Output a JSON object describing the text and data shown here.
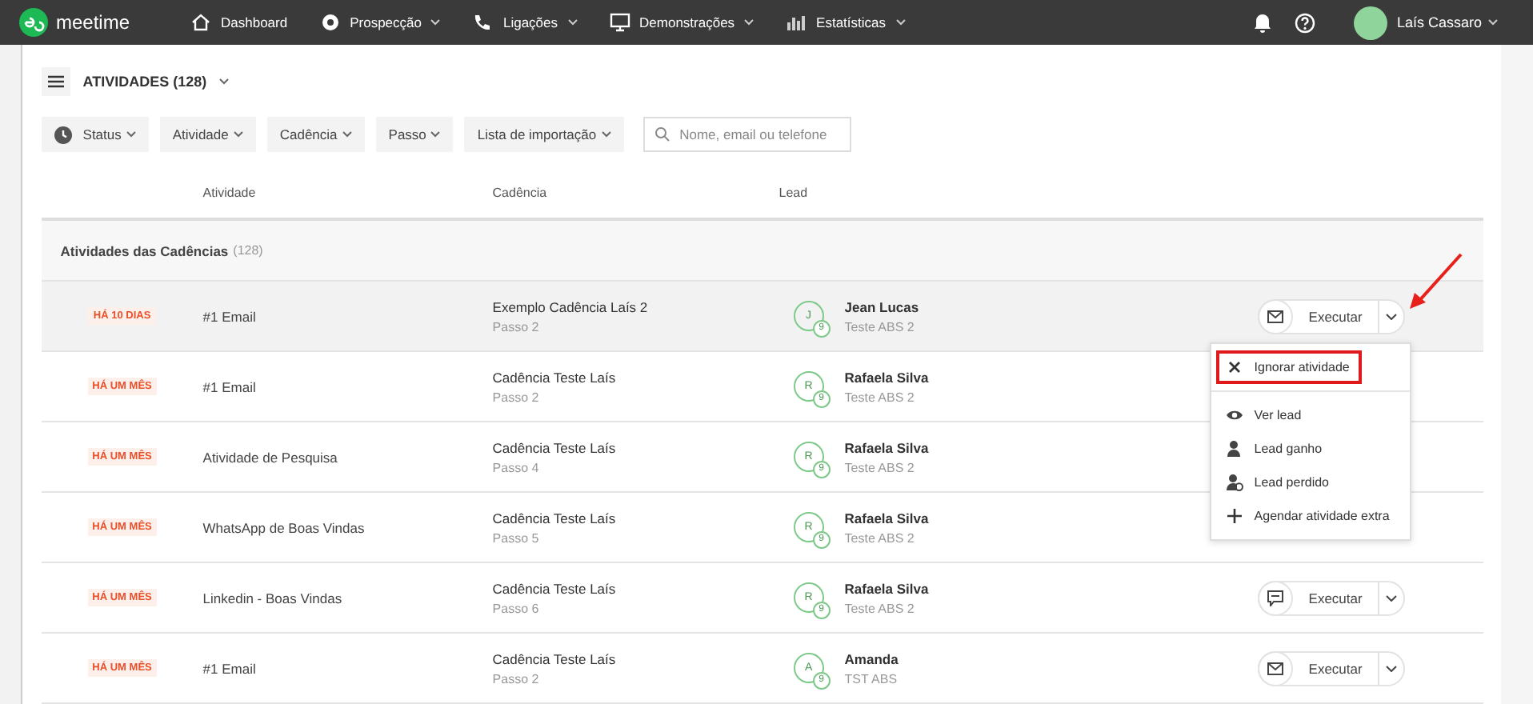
{
  "topbar": {
    "logo": "meetime",
    "nav": [
      {
        "label": "Dashboard",
        "kind": "home",
        "dropdown": false
      },
      {
        "label": "Prospecção",
        "kind": "target",
        "dropdown": true
      },
      {
        "label": "Ligações",
        "kind": "phone",
        "dropdown": true
      },
      {
        "label": "Demonstrações",
        "kind": "monitor",
        "dropdown": true
      },
      {
        "label": "Estatísticas",
        "kind": "chart",
        "dropdown": true
      }
    ],
    "user": "Laís Cassaro"
  },
  "page": {
    "title": "ATIVIDADES (128)"
  },
  "filters": [
    {
      "label": "Status",
      "kind": "status"
    },
    {
      "label": "Atividade",
      "kind": "plain"
    },
    {
      "label": "Cadência",
      "kind": "plain"
    },
    {
      "label": "Passo",
      "kind": "plain"
    },
    {
      "label": "Lista de importação",
      "kind": "plain"
    }
  ],
  "search": {
    "placeholder": "Nome, email ou telefone"
  },
  "table": {
    "columns": [
      "Atividade",
      "Cadência",
      "Lead"
    ],
    "group": {
      "title": "Atividades das Cadências",
      "count": "(128)"
    },
    "rows": [
      {
        "due": "HÁ 10 DIAS",
        "activity": "#1 Email",
        "cadence": "Exemplo Cadência Laís 2",
        "step": "Passo 2",
        "initial": "J",
        "badge": "9",
        "lead": "Jean Lucas",
        "company": "Teste ABS 2",
        "selected": true,
        "action": {
          "kind": "email",
          "label": "Executar"
        }
      },
      {
        "due": "HÁ UM MÊS",
        "activity": "#1 Email",
        "cadence": "Cadência Teste Laís",
        "step": "Passo 2",
        "initial": "R",
        "badge": "9",
        "lead": "Rafaela Silva",
        "company": "Teste ABS 2",
        "selected": false
      },
      {
        "due": "HÁ UM MÊS",
        "activity": "Atividade de Pesquisa",
        "cadence": "Cadência Teste Laís",
        "step": "Passo 4",
        "initial": "R",
        "badge": "9",
        "lead": "Rafaela Silva",
        "company": "Teste ABS 2",
        "selected": false
      },
      {
        "due": "HÁ UM MÊS",
        "activity": "WhatsApp de Boas Vindas",
        "cadence": "Cadência Teste Laís",
        "step": "Passo 5",
        "initial": "R",
        "badge": "9",
        "lead": "Rafaela Silva",
        "company": "Teste ABS 2",
        "selected": false
      },
      {
        "due": "HÁ UM MÊS",
        "activity": "Linkedin - Boas Vindas",
        "cadence": "Cadência Teste Laís",
        "step": "Passo 6",
        "initial": "R",
        "badge": "9",
        "lead": "Rafaela Silva",
        "company": "Teste ABS 2",
        "selected": false,
        "action": {
          "kind": "chat",
          "label": "Executar"
        }
      },
      {
        "due": "HÁ UM MÊS",
        "activity": "#1 Email",
        "cadence": "Cadência Teste Laís",
        "step": "Passo 2",
        "initial": "A",
        "badge": "9",
        "lead": "Amanda",
        "company": "TST ABS",
        "selected": false,
        "action": {
          "kind": "email",
          "label": "Executar"
        }
      }
    ]
  },
  "menu": {
    "items": [
      {
        "label": "Ignorar atividade",
        "kind": "close",
        "highlighted": true
      },
      {
        "label": "Ver lead",
        "kind": "eye",
        "highlighted": false
      },
      {
        "label": "Lead ganho",
        "kind": "user",
        "highlighted": false
      },
      {
        "label": "Lead perdido",
        "kind": "user-x",
        "highlighted": false
      },
      {
        "label": "Agendar atividade extra",
        "kind": "plus",
        "highlighted": false
      }
    ]
  }
}
